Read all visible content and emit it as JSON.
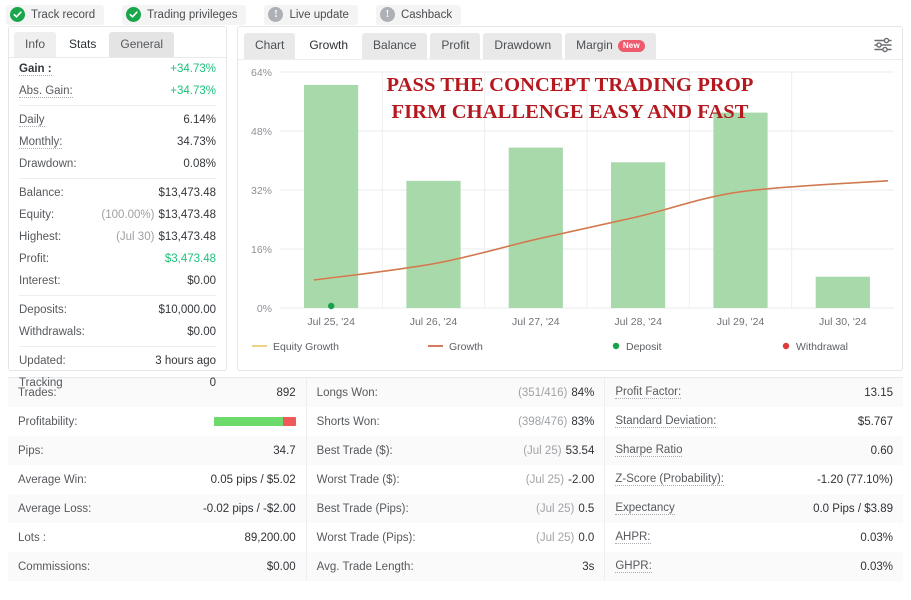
{
  "badges": [
    {
      "label": "Track record",
      "icon": "check-circle-icon",
      "state": "on"
    },
    {
      "label": "Trading privileges",
      "icon": "check-circle-icon",
      "state": "on"
    },
    {
      "label": "Live update",
      "icon": "info-circle-icon",
      "state": "off"
    },
    {
      "label": "Cashback",
      "icon": "info-circle-icon",
      "state": "off"
    }
  ],
  "sidebar": {
    "tabs": [
      {
        "label": "Info",
        "active": false,
        "style": "light"
      },
      {
        "label": "Stats",
        "active": true,
        "style": "active"
      },
      {
        "label": "General",
        "active": false,
        "style": "dark"
      }
    ],
    "groups": [
      {
        "rows": [
          {
            "key": "Gain :",
            "value": "+34.73%",
            "bold": true,
            "dotted": true,
            "green": true
          },
          {
            "key": "Abs. Gain:",
            "value": "+34.73%",
            "dotted": true,
            "green": true
          }
        ]
      },
      {
        "rows": [
          {
            "key": "Daily",
            "value": "6.14%",
            "dotted": true
          },
          {
            "key": "Monthly:",
            "value": "34.73%",
            "dotted": true
          },
          {
            "key": "Drawdown:",
            "value": "0.08%",
            "dotted": false
          }
        ]
      },
      {
        "rows": [
          {
            "key": "Balance:",
            "value": "$13,473.48"
          },
          {
            "key": "Equity:",
            "prefix": "(100.00%)",
            "value": "$13,473.48"
          },
          {
            "key": "Highest:",
            "prefix": "(Jul 30)",
            "value": "$13,473.48"
          },
          {
            "key": "Profit:",
            "value": "$3,473.48",
            "green": true
          },
          {
            "key": "Interest:",
            "value": "$0.00"
          }
        ]
      },
      {
        "rows": [
          {
            "key": "Deposits:",
            "value": "$10,000.00"
          },
          {
            "key": "Withdrawals:",
            "value": "$0.00"
          }
        ]
      },
      {
        "rows": [
          {
            "key": "Updated:",
            "value": "3 hours ago"
          },
          {
            "key": "Tracking",
            "value": "0"
          }
        ]
      }
    ]
  },
  "chart_panel": {
    "tabs": [
      {
        "label": "Chart",
        "active": false
      },
      {
        "label": "Growth",
        "active": true
      },
      {
        "label": "Balance",
        "active": false
      },
      {
        "label": "Profit",
        "active": false
      },
      {
        "label": "Drawdown",
        "active": false
      },
      {
        "label": "Margin",
        "active": false,
        "badge": "New"
      }
    ],
    "settings_icon": "sliders-icon",
    "overlay_lines": [
      "PASS THE CONCEPT TRADING PROP",
      "FIRM CHALLENGE EASY AND FAST"
    ],
    "overlay_color": "#b5191f"
  },
  "chart_data": {
    "type": "bar",
    "title": "",
    "xlabel": "",
    "ylabel": "",
    "categories": [
      "Jul 25, '24",
      "Jul 26, '24",
      "Jul 27, '24",
      "Jul 28, '24",
      "Jul 29, '24",
      "Jul 30, '24"
    ],
    "ytick_labels": [
      "0%",
      "16%",
      "32%",
      "48%",
      "64%"
    ],
    "ytick_values": [
      0,
      16,
      32,
      48,
      64
    ],
    "ylim": [
      0,
      64
    ],
    "grid": true,
    "legend_position": "bottom",
    "bar_color": "#a8d9ab",
    "series": [
      {
        "name": "Bars",
        "type": "bar",
        "values": [
          60.5,
          34.5,
          43.5,
          39.5,
          53.0,
          8.5
        ]
      },
      {
        "name": "Growth",
        "type": "line",
        "color": "#cd6a4e",
        "values": [
          7.6,
          12.0,
          18.6,
          24.8,
          31.5,
          34.5
        ]
      },
      {
        "name": "Equity Growth",
        "type": "line",
        "color": "#e6c46a",
        "values": [
          7.6,
          12.0,
          18.6,
          24.8,
          31.5,
          34.5
        ]
      }
    ],
    "markers": [
      {
        "name": "Deposit",
        "color": "#16a34a",
        "x": "Jul 25, '24",
        "y": 0
      }
    ],
    "legend": [
      {
        "label": "Equity Growth",
        "color": "#e8cd7a",
        "shape": "line"
      },
      {
        "label": "Growth",
        "color": "#cd6a4e",
        "shape": "line"
      },
      {
        "label": "Deposit",
        "color": "#15a349",
        "shape": "dot"
      },
      {
        "label": "Withdrawal",
        "color": "#e03b3b",
        "shape": "dot"
      }
    ]
  },
  "stats": {
    "col1": [
      {
        "key": "Trades:",
        "value": "892",
        "dotted": false
      },
      {
        "key": "Profitability:",
        "value": "",
        "bar": 84,
        "dotted": false
      },
      {
        "key": "Pips:",
        "value": "34.7",
        "dotted": false
      },
      {
        "key": "Average Win:",
        "value": "0.05 pips / $5.02",
        "dotted": false
      },
      {
        "key": "Average Loss:",
        "value": "-0.02 pips / -$2.00",
        "dotted": false
      },
      {
        "key": "Lots :",
        "value": "89,200.00",
        "dotted": false
      },
      {
        "key": "Commissions:",
        "value": "$0.00",
        "dotted": false
      }
    ],
    "col2": [
      {
        "key": "Longs Won:",
        "prefix": "(351/416)",
        "value": "84%",
        "dotted": false
      },
      {
        "key": "Shorts Won:",
        "prefix": "(398/476)",
        "value": "83%",
        "dotted": false
      },
      {
        "key": "Best Trade ($):",
        "prefix": "(Jul 25)",
        "value": "53.54",
        "dotted": false
      },
      {
        "key": "Worst Trade ($):",
        "prefix": "(Jul 25)",
        "value": "-2.00",
        "dotted": false
      },
      {
        "key": "Best Trade (Pips):",
        "prefix": "(Jul 25)",
        "value": "0.5",
        "dotted": false
      },
      {
        "key": "Worst Trade (Pips):",
        "prefix": "(Jul 25)",
        "value": "0.0",
        "dotted": false
      },
      {
        "key": "Avg. Trade Length:",
        "value": "3s",
        "dotted": false
      }
    ],
    "col3": [
      {
        "key": "Profit Factor:",
        "value": "13.15",
        "dotted": true
      },
      {
        "key": "Standard Deviation:",
        "value": "$5.767",
        "dotted": true
      },
      {
        "key": "Sharpe Ratio",
        "value": "0.60",
        "dotted": true
      },
      {
        "key": "Z-Score (Probability):",
        "value": "-1.20 (77.10%)",
        "dotted": true
      },
      {
        "key": "Expectancy",
        "value": "0.0 Pips / $3.89",
        "dotted": true
      },
      {
        "key": "AHPR:",
        "value": "0.03%",
        "dotted": true
      },
      {
        "key": "GHPR:",
        "value": "0.03%",
        "dotted": true
      }
    ]
  }
}
